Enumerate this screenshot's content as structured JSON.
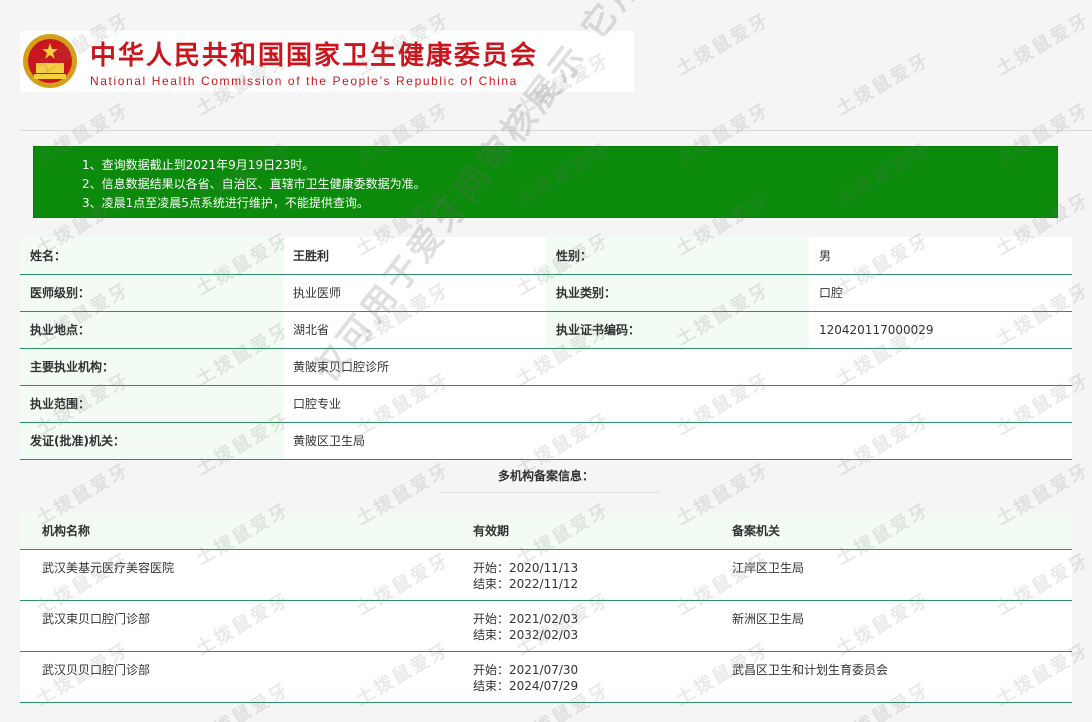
{
  "header": {
    "title": "中华人民共和国国家卫生健康委员会",
    "subtitle": "National Health Commission of the People’s Republic of China"
  },
  "notice": [
    "1、查询数据截止到2021年9月19日23时。",
    "2、信息数据结果以各省、自治区、直辖市卫生健康委数据为准。",
    "3、凌晨1点至凌晨5点系统进行维护，不能提供查询。"
  ],
  "info": {
    "name_label": "姓名：",
    "name": "王胜利",
    "gender_label": "性别：",
    "gender": "男",
    "level_label": "医师级别：",
    "level": "执业医师",
    "type_label": "执业类别：",
    "type": "口腔",
    "place_label": "执业地点：",
    "place": "湖北省",
    "cert_label": "执业证书编码：",
    "cert": "120420117000029",
    "org_label": "主要执业机构：",
    "org": "黄陂束贝口腔诊所",
    "scope_label": "执业范围：",
    "scope": "口腔专业",
    "issuer_label": "发证(批准)机关：",
    "issuer": "黄陂区卫生局"
  },
  "multi": {
    "title": "多机构备案信息：",
    "headers": [
      "机构名称",
      "有效期",
      "备案机关"
    ],
    "rows": [
      {
        "name": "武汉美基元医疗美容医院",
        "start": "开始：2020/11/13",
        "end": "结束：2022/11/12",
        "authority": "江岸区卫生局"
      },
      {
        "name": "武汉束贝口腔门诊部",
        "start": "开始：2021/02/03",
        "end": "结束：2032/02/03",
        "authority": "新洲区卫生局"
      },
      {
        "name": "武汉贝贝口腔门诊部",
        "start": "开始：2021/07/30",
        "end": "结束：2024/07/29",
        "authority": "武昌区卫生和计划生育委员会"
      }
    ]
  },
  "watermark": {
    "small": "土拨鼠爱牙",
    "big": "仅可用于爱牙网审核展示  它用无效"
  },
  "colors": {
    "brand_red": "#c9161d",
    "notice_green": "#0b8a0b",
    "row_rule": "#2f8f6a"
  }
}
